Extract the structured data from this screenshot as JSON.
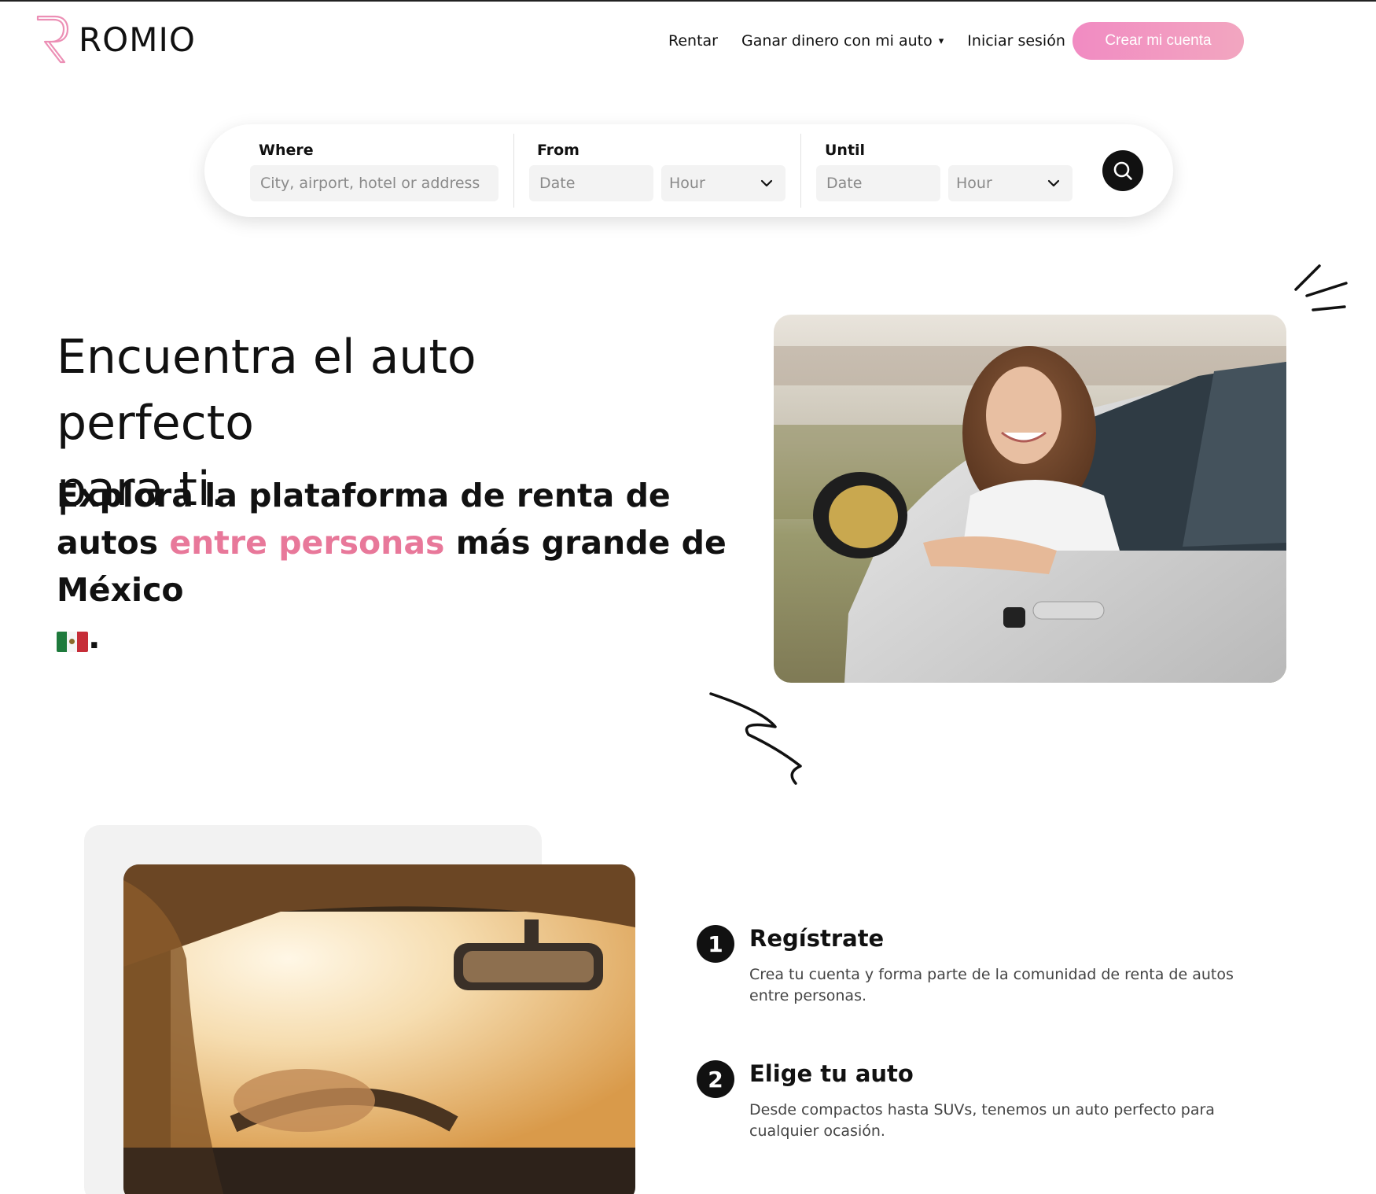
{
  "header": {
    "logo_text": "ROMIO",
    "nav": [
      {
        "label": "Rentar"
      },
      {
        "label": "Ganar dinero con mi auto",
        "dropdown": true
      },
      {
        "label": "Iniciar sesión"
      }
    ],
    "cta_label": "Crear mi cuenta",
    "caret": "▾"
  },
  "search": {
    "where_label": "Where",
    "where_placeholder": "City, airport, hotel or address",
    "from_label": "From",
    "from_date_placeholder": "Date",
    "from_hour": "Hour",
    "until_label": "Until",
    "until_date_placeholder": "Date",
    "until_hour": "Hour"
  },
  "hero": {
    "title_line1": "Encuentra el auto perfecto",
    "title_line2": "para ti.",
    "subtitle_part1": "Explora la plataforma de renta de autos",
    "subtitle_highlight": "entre personas",
    "subtitle_part2": "más grande de México",
    "subtitle_end": "."
  },
  "steps": [
    {
      "number": "1",
      "title": "Regístrate",
      "description": "Crea tu cuenta y forma parte de la comunidad de renta de autos entre personas."
    },
    {
      "number": "2",
      "title": "Elige tu auto",
      "description": "Desde compactos hasta SUVs, tenemos un auto perfecto para cualquier ocasión."
    }
  ],
  "colors": {
    "accent_pink": "#e8789a",
    "cta_gradient_start": "#f18bc2",
    "cta_gradient_end": "#f2a6c0",
    "dark": "#111111"
  },
  "icons": {
    "search_button": "search-icon",
    "dropdown": "chevron-down-icon",
    "flag": "mexico-flag-emoji"
  }
}
